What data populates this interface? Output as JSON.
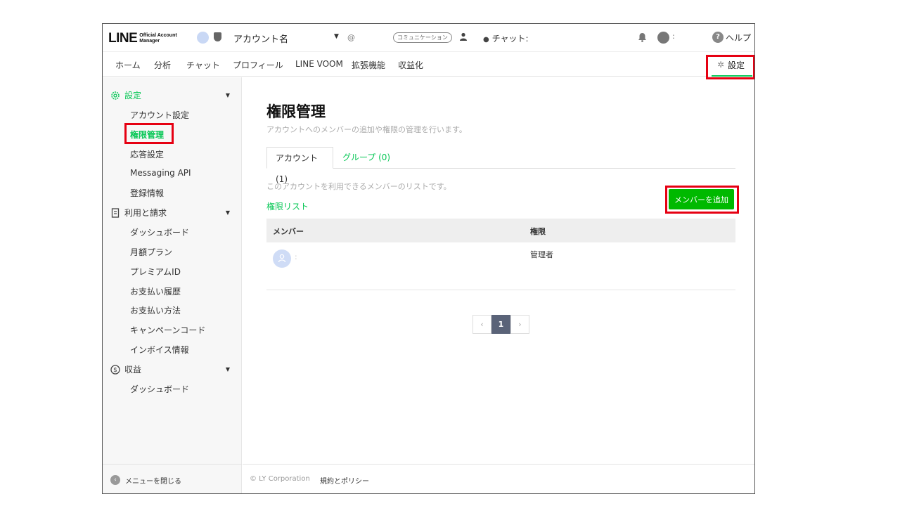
{
  "header": {
    "logo_text": "LINE",
    "logo_sub": "Official Account Manager",
    "account_name": "アカウント名",
    "at_label": "@",
    "comm_badge": "コミュニケーション",
    "chat_label": "チャット:",
    "user_colon": ":",
    "help_label": "ヘルプ"
  },
  "nav": {
    "items": [
      "ホーム",
      "分析",
      "チャット",
      "プロフィール",
      "LINE VOOM",
      "拡張機能",
      "収益化"
    ],
    "settings_label": "設定"
  },
  "sidebar": {
    "sections": [
      {
        "label": "設定",
        "items": [
          "アカウント設定",
          "権限管理",
          "応答設定",
          "Messaging API",
          "登録情報"
        ]
      },
      {
        "label": "利用と請求",
        "items": [
          "ダッシュボード",
          "月額プラン",
          "プレミアムID",
          "お支払い履歴",
          "お支払い方法",
          "キャンペーンコード",
          "インボイス情報"
        ]
      },
      {
        "label": "収益",
        "items": [
          "ダッシュボード"
        ]
      }
    ],
    "active_item": "権限管理",
    "collapse_label": "メニューを閉じる"
  },
  "main": {
    "title": "権限管理",
    "description": "アカウントへのメンバーの追加や権限の管理を行います。",
    "tabs": [
      {
        "label": "アカウント (1)",
        "active": true
      },
      {
        "label": "グループ (0)",
        "active": false
      }
    ],
    "list_description": "このアカウントを利用できるメンバーのリストです。",
    "permission_list_link": "権限リスト",
    "add_member_button": "メンバーを追加",
    "table": {
      "headers": [
        "メンバー",
        "権限"
      ],
      "rows": [
        {
          "member": ":",
          "role": "管理者"
        }
      ]
    },
    "pagination": {
      "prev": "‹",
      "current": "1",
      "next": "›"
    }
  },
  "footer": {
    "copyright": "© LY Corporation",
    "policy": "規約とポリシー"
  },
  "colors": {
    "accent": "#06c755",
    "button": "#00b900",
    "highlight": "#e60012"
  }
}
